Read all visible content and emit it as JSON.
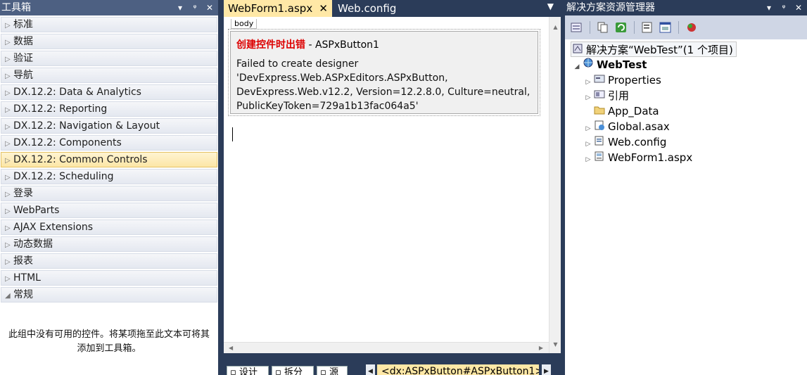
{
  "toolbox": {
    "title": "工具箱",
    "pin": "▾",
    "autohide": "ᵠ",
    "close": "✕",
    "groups": [
      {
        "label": "标准",
        "expanded": false,
        "selected": false
      },
      {
        "label": "数据",
        "expanded": false,
        "selected": false
      },
      {
        "label": "验证",
        "expanded": false,
        "selected": false
      },
      {
        "label": "导航",
        "expanded": false,
        "selected": false
      },
      {
        "label": "DX.12.2: Data & Analytics",
        "expanded": false,
        "selected": false
      },
      {
        "label": "DX.12.2: Reporting",
        "expanded": false,
        "selected": false
      },
      {
        "label": "DX.12.2: Navigation & Layout",
        "expanded": false,
        "selected": false
      },
      {
        "label": "DX.12.2: Components",
        "expanded": false,
        "selected": false
      },
      {
        "label": "DX.12.2: Common Controls",
        "expanded": false,
        "selected": true
      },
      {
        "label": "DX.12.2: Scheduling",
        "expanded": false,
        "selected": false
      },
      {
        "label": "登录",
        "expanded": false,
        "selected": false
      },
      {
        "label": "WebParts",
        "expanded": false,
        "selected": false
      },
      {
        "label": "AJAX Extensions",
        "expanded": false,
        "selected": false
      },
      {
        "label": "动态数据",
        "expanded": false,
        "selected": false
      },
      {
        "label": "报表",
        "expanded": false,
        "selected": false
      },
      {
        "label": "HTML",
        "expanded": false,
        "selected": false
      },
      {
        "label": "常规",
        "expanded": true,
        "selected": false
      }
    ],
    "empty_message": "此组中没有可用的控件。将某项拖至此文本可将其添加到工具箱。"
  },
  "editor": {
    "tabs": [
      {
        "label": "WebForm1.aspx",
        "active": true,
        "close": "✕"
      },
      {
        "label": "Web.config",
        "active": false
      }
    ],
    "tab_menu": "▼",
    "body_tag": "body",
    "error": {
      "title_prefix": "创建控件时出错",
      "title_suffix": " - ASPxButton1",
      "message_lines": [
        "Failed to create designer",
        "'DevExpress.Web.ASPxEditors.ASPxButton,",
        "DevExpress.Web.v12.2, Version=12.2.8.0, Culture=neutral,",
        "PublicKeyToken=729a1b13fac064a5'"
      ]
    },
    "view_buttons": [
      "设计",
      "拆分",
      "源"
    ],
    "breadcrumb": "<dx:ASPxButton#ASPxButton1>"
  },
  "solution_explorer": {
    "title": "解决方案资源管理器",
    "solution_label": "解决方案“WebTest”(1 个项目)",
    "project": "WebTest",
    "items": [
      {
        "label": "Properties",
        "icon": "properties-icon",
        "expandable": true
      },
      {
        "label": "引用",
        "icon": "references-icon",
        "expandable": true
      },
      {
        "label": "App_Data",
        "icon": "folder-icon",
        "expandable": false
      },
      {
        "label": "Global.asax",
        "icon": "global-asax-icon",
        "expandable": true
      },
      {
        "label": "Web.config",
        "icon": "config-file-icon",
        "expandable": true
      },
      {
        "label": "WebForm1.aspx",
        "icon": "aspx-file-icon",
        "expandable": true
      }
    ]
  }
}
